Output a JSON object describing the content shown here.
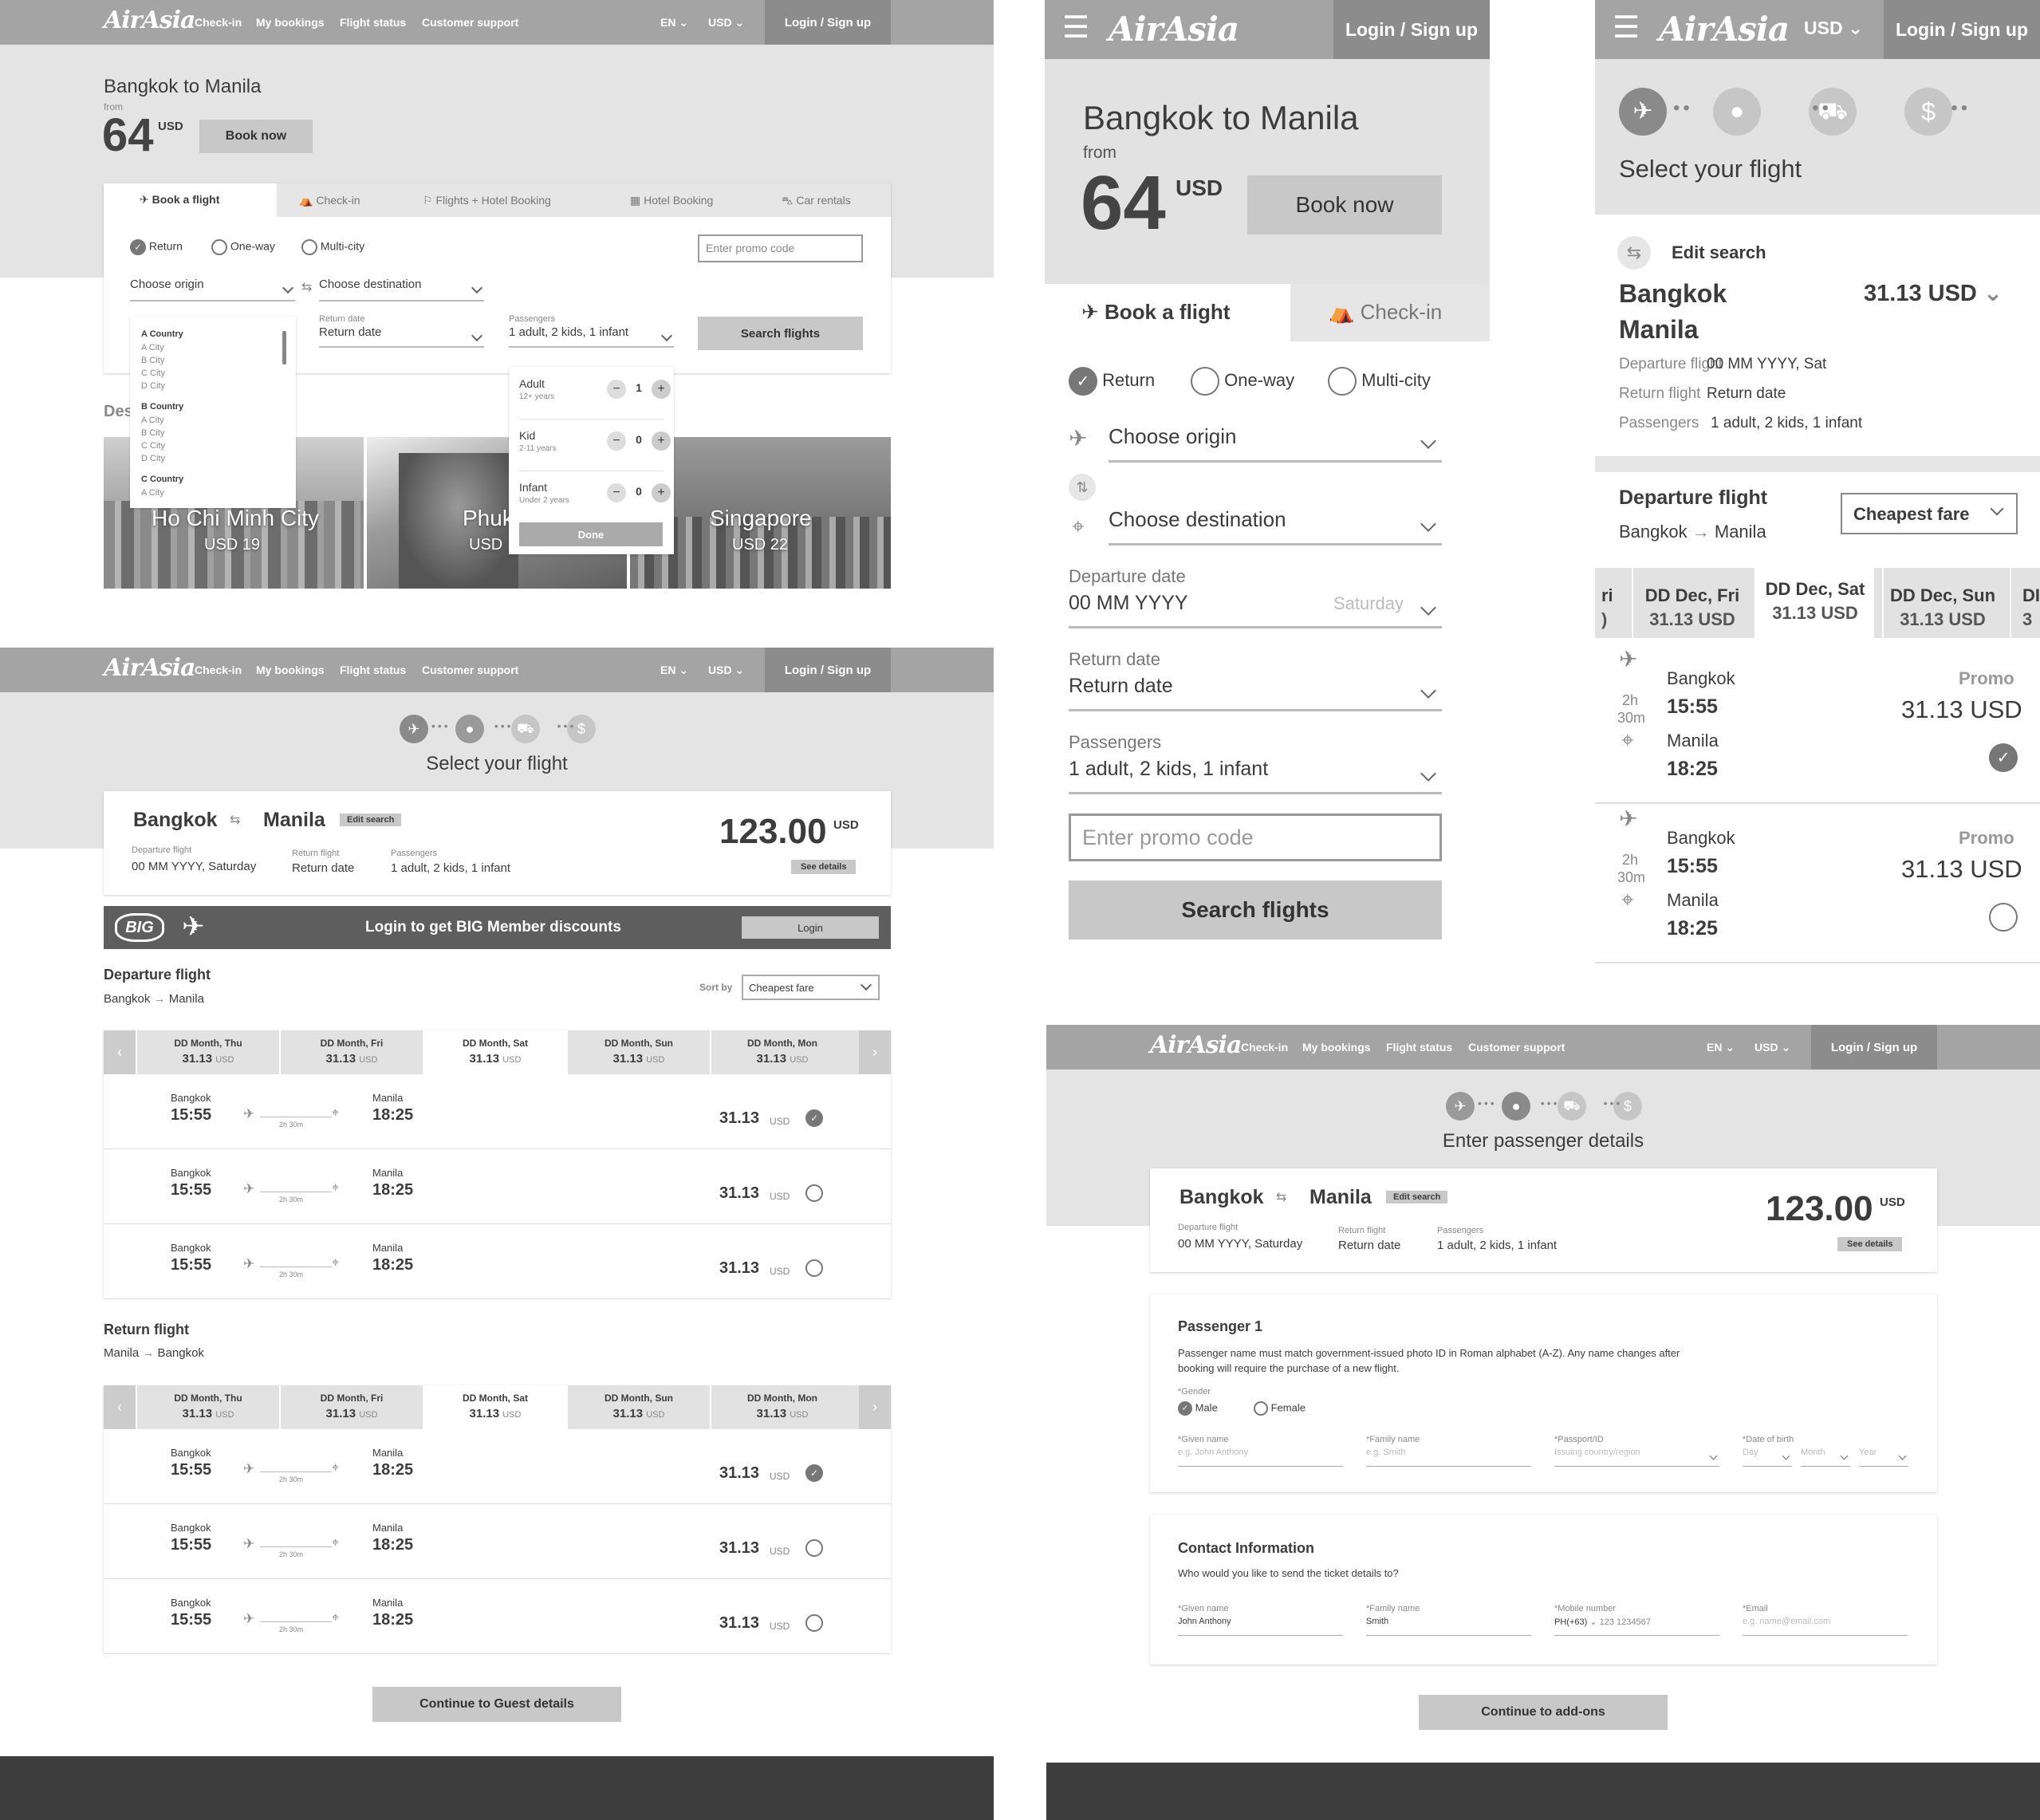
{
  "brand": "AirAsia",
  "nav": [
    "Check-in",
    "My bookings",
    "Flight status",
    "Customer support"
  ],
  "lang": "EN",
  "currency": "USD",
  "login": "Login / Sign up",
  "landing": {
    "title": "Bangkok to Manila",
    "from": "from",
    "price": "64",
    "unit": "USD",
    "book": "Book now",
    "tabs": [
      "Book a flight",
      "Check-in",
      "Flights + Hotel Booking",
      "Hotel Booking",
      "Car rentals"
    ],
    "trip": [
      "Return",
      "One-way",
      "Multi-city"
    ],
    "promo": "Enter promo code",
    "origin": "Choose origin",
    "destination": "Choose destination",
    "return_label": "Return date",
    "return_value": "Return date",
    "pax_label": "Passengers",
    "pax_value": "1 adult, 2 kids, 1 infant",
    "search": "Search flights",
    "dropdown": [
      {
        "country": "A Country",
        "cities": [
          "A City",
          "B City",
          "C City",
          "D City"
        ]
      },
      {
        "country": "B Country",
        "cities": [
          "A City",
          "B City",
          "C City",
          "D City"
        ]
      },
      {
        "country": "C Country",
        "cities": [
          "A City"
        ]
      }
    ],
    "pax": [
      {
        "name": "Adult",
        "sub": "12+ years",
        "count": "1"
      },
      {
        "name": "Kid",
        "sub": "2-11 years",
        "count": "0"
      },
      {
        "name": "Infant",
        "sub": "Under 2 years",
        "count": "0"
      }
    ],
    "done": "Done",
    "dest_heading": "Des",
    "dests": [
      {
        "name": "Ho Chi Minh City",
        "price": "USD 19"
      },
      {
        "name": "Phuk",
        "price": "USD"
      },
      {
        "name": "Singapore",
        "price": "USD 22"
      }
    ]
  },
  "select": {
    "title": "Select your flight",
    "from": "Bangkok",
    "to": "Manila",
    "edit": "Edit search",
    "price": "123.00",
    "unit": "USD",
    "details": "See details",
    "dep_label": "Departure flight",
    "dep_value": "00 MM YYYY, Saturday",
    "ret_label": "Return flight",
    "ret_value": "Return date",
    "pax_label": "Passengers",
    "pax_value": "1 adult, 2 kids, 1 infant",
    "big_text": "Login to get BIG Member discounts",
    "big_login": "Login",
    "big_logo": "BIG",
    "dep_heading": "Departure flight",
    "dep_route_from": "Bangkok",
    "dep_route_to": "Manila",
    "sort_label": "Sort by",
    "sort_value": "Cheapest fare",
    "dates": [
      {
        "d": "DD Month, Thu",
        "p": "31.13"
      },
      {
        "d": "DD Month, Fri",
        "p": "31.13"
      },
      {
        "d": "DD Month, Sat",
        "p": "31.13"
      },
      {
        "d": "DD Month, Sun",
        "p": "31.13"
      },
      {
        "d": "DD Month, Mon",
        "p": "31.13"
      }
    ],
    "flights": [
      {
        "from": "Bangkok",
        "dep": "15:55",
        "dur": "2h 30m",
        "to": "Manila",
        "arr": "18:25",
        "price": "31.13",
        "sel": true
      },
      {
        "from": "Bangkok",
        "dep": "15:55",
        "dur": "2h 30m",
        "to": "Manila",
        "arr": "18:25",
        "price": "31.13",
        "sel": false
      },
      {
        "from": "Bangkok",
        "dep": "15:55",
        "dur": "2h 30m",
        "to": "Manila",
        "arr": "18:25",
        "price": "31.13",
        "sel": false
      }
    ],
    "ret_heading": "Return flight",
    "ret_route_from": "Manila",
    "ret_route_to": "Bangkok",
    "continue": "Continue to Guest details"
  },
  "mobile1": {
    "tabs": [
      "Book a flight",
      "Check-in"
    ],
    "departure_label": "Departure date",
    "departure_value": "00 MM YYYY",
    "departure_day": "Saturday"
  },
  "mobile2": {
    "edit": "Edit search",
    "from": "Bangkok",
    "to": "Manila",
    "price": "31.13 USD",
    "rows": [
      {
        "k": "Departure flight",
        "v": "00 MM YYYY, Sat"
      },
      {
        "k": "Return flight",
        "v": "Return date"
      },
      {
        "k": "Passengers",
        "v": "1 adult, 2 kids, 1 infant"
      }
    ],
    "dates": [
      {
        "d": "ri",
        "p": ")"
      },
      {
        "d": "DD Dec, Fri",
        "p": "31.13 USD"
      },
      {
        "d": "DD Dec, Sat",
        "p": "31.13 USD"
      },
      {
        "d": "DD Dec, Sun",
        "p": "31.13 USD"
      },
      {
        "d": "DI",
        "p": "3"
      }
    ],
    "promo": "Promo",
    "dur": [
      "2h",
      "30m"
    ]
  },
  "passenger": {
    "title": "Enter passenger details",
    "p1": "Passenger 1",
    "note": "Passenger name must match government-issued photo ID in Roman alphabet (A-Z). Any name changes after booking will require the purchase of a new flight.",
    "gender": "*Gender",
    "male": "Male",
    "female": "Female",
    "fields": [
      {
        "l": "*Given name",
        "p": "e.g. John Anthony"
      },
      {
        "l": "*Family name",
        "p": "e.g. Smith"
      },
      {
        "l": "*Passport/ID",
        "p": "Issuing country/region"
      },
      {
        "l": "*Date of birth",
        "p": ""
      }
    ],
    "dob": [
      "Day",
      "Month",
      "Year"
    ],
    "contact": "Contact Information",
    "contact_q": "Who would you like to send the ticket details to?",
    "cfields": [
      {
        "l": "*Given name",
        "v": "John Anthony"
      },
      {
        "l": "*Family name",
        "v": "Smith"
      },
      {
        "l": "*Mobile number",
        "v": "PH(+63)"
      },
      {
        "l": "*Email",
        "v": "e.g. name@email.com"
      }
    ],
    "mobile_parts": [
      "123",
      "1234567"
    ],
    "continue": "Continue to add-ons"
  }
}
